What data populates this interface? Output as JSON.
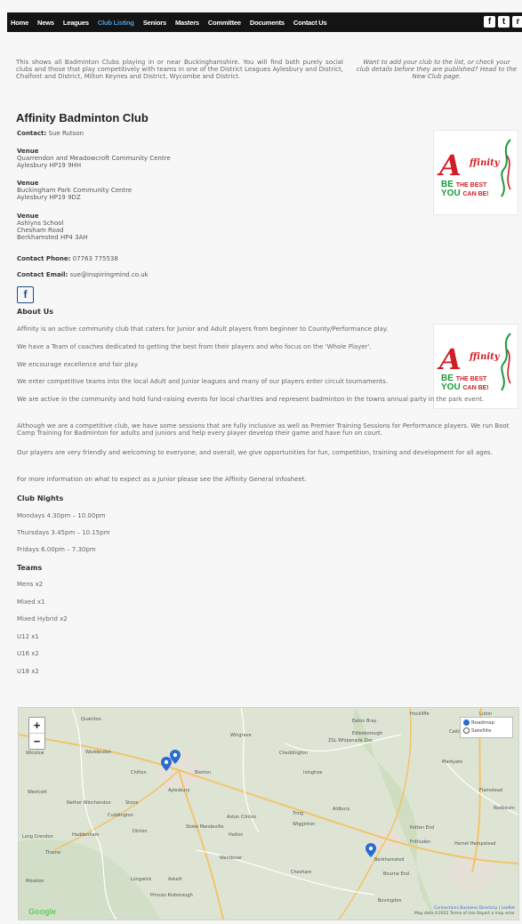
{
  "nav": {
    "links": [
      "Home",
      "News",
      "Leagues",
      "Club Listing",
      "Seniors",
      "Masters",
      "Committee",
      "Documents",
      "Contact Us"
    ],
    "active_index": 3,
    "social_icons": [
      "facebook-icon",
      "twitter-icon",
      "rss-icon"
    ],
    "social_glyphs": [
      "f",
      "t",
      "r"
    ]
  },
  "intro": {
    "text": "This shows all Badminton Clubs playing in or near Buckinghamshire. You will find both purely social clubs and those that play competitively with teams in one of the District Leagues Aylesbury and District, Chalfont and District, Milton Keynes and District, Wycombe and District.",
    "aside": "Want to add your club to the list, or check your club details before they are published? Head to the New Club page."
  },
  "club": {
    "name": "Affinity Badminton Club",
    "contact_label": "Contact:",
    "contact": "Sue Rutson",
    "venue_label": "Venue",
    "venues": [
      [
        "Quarrendon and Meadowcroft Community Centre",
        "Aylesbury HP19 9HH"
      ],
      [
        "Buckingham Park Community Centre",
        "Aylesbury HP19 9DZ"
      ],
      [
        "Ashlyns School",
        "Chesham Road",
        "Berkhamsted HP4 3AH"
      ]
    ],
    "phone_label": "Contact Phone:",
    "phone": "07763 775538",
    "email_label": "Contact Email:",
    "email": "sue@inspiringmind.co.uk",
    "facebook_glyph": "f",
    "logo_text": [
      "A",
      "ffinity",
      "BE",
      "THE BEST",
      "YOU",
      "CAN BE!"
    ]
  },
  "about": {
    "heading": "About Us",
    "paragraphs": [
      "Affinity is an active community club that caters for Junior and Adult players from beginner to County/Performance play.",
      "We have a Team of coaches dedicated to getting the best from their players and who focus on the 'Whole Player'.",
      "We encourage excellence and fair play.",
      "We enter competitive teams into the local Adult and Junior leagues and many of our players enter circuit tournaments.",
      "We are active in the community and hold fund-raising events for local charities and represent badminton in the towns annual party in the park event.",
      "Although we are a competitive club, we have some sessions that are fully inclusive as well as Premier Training Sessions for Performance players. We run Boot Camp Training for Badminton for adults and juniors and help every player develop their game and have fun on court.",
      "Our players are very friendly and welcoming to everyone; and overall, we give opportunities for fun, competition, training and development for all ages.",
      "For more information on what to expect as a Junior please see the Affinity General Infosheet."
    ]
  },
  "club_nights": {
    "heading": "Club Nights",
    "items": [
      "Mondays 4.30pm – 10.00pm",
      "Thursdays 3.45pm – 10.15pm",
      "Fridays 6.00pm – 7.30pm"
    ]
  },
  "teams": {
    "heading": "Teams",
    "items": [
      "Mens x2",
      "Mixed x1",
      "Mixed Hybrid x2",
      "U12 x1",
      "U16 x2",
      "U18 x2"
    ]
  },
  "map": {
    "zoom_in": "+",
    "zoom_out": "−",
    "types": [
      "Roadmap",
      "Satellite"
    ],
    "selected_type": "Roadmap",
    "places": [
      "Quainton",
      "Waddesdon",
      "Winslow",
      "Aylesbury",
      "Bierton",
      "Wingrave",
      "Cheddington",
      "Ivinghoe",
      "Edlesborough",
      "Eaton Bray",
      "Luton",
      "Caddington",
      "Markyate",
      "Flamstead",
      "Redbourn",
      "Aldbury",
      "Tring",
      "Wigginton",
      "Berkhamsted",
      "Bourne End",
      "Hemel Hempstead",
      "Chesham",
      "Stoke Mandeville",
      "Aston Clinton",
      "Halton",
      "Wendover",
      "Nether Winchendon",
      "Cuddington",
      "Haddenham",
      "Long Crendon",
      "Thame",
      "Moreton",
      "Princes Risborough",
      "Longwick",
      "Askett",
      "Frithsden",
      "Bovingdon",
      "Potten End",
      "Chilton",
      "ZSL Whipsnade Zoo",
      "Hockliffe",
      "Stone",
      "Dinton",
      "Westcott"
    ],
    "google": "Google",
    "attribution_line1": "Connections Business Directory | Leaflet",
    "attribution_line2": "Map data ©2022   Terms of Use   Report a map error"
  }
}
